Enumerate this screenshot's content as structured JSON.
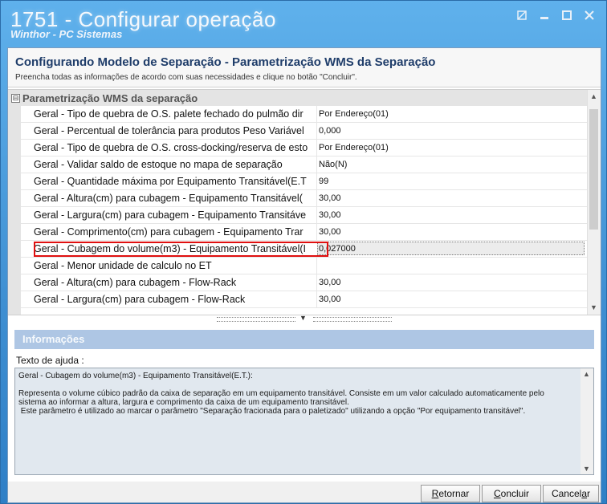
{
  "window": {
    "title": "1751 - Configurar operação",
    "subtitle": "Winthor - PC Sistemas"
  },
  "header": {
    "title": "Configurando Modelo de Separação - Parametrização WMS da Separação",
    "subtitle": "Preencha todas as informações de acordo com suas necessidades e clique no botão \"Concluir\"."
  },
  "grid": {
    "category": "Parametrização WMS da separação",
    "category_toggle": "⊟",
    "rows": [
      {
        "name": "Geral - Tipo de quebra de O.S. palete fechado do pulmão dir",
        "value": "Por Endereço(01)"
      },
      {
        "name": "Geral - Percentual de tolerância para produtos Peso Variável",
        "value": "0,000"
      },
      {
        "name": "Geral - Tipo de quebra de O.S. cross-docking/reserva de esto",
        "value": "Por Endereço(01)"
      },
      {
        "name": "Geral - Validar saldo de estoque no mapa de separação",
        "value": "Não(N)"
      },
      {
        "name": "Geral - Quantidade máxima por Equipamento Transitável(E.T",
        "value": "99"
      },
      {
        "name": "Geral - Altura(cm) para cubagem - Equipamento Transitável(",
        "value": "30,00"
      },
      {
        "name": "Geral - Largura(cm) para cubagem - Equipamento Transitáve",
        "value": "30,00"
      },
      {
        "name": "Geral - Comprimento(cm) para cubagem - Equipamento Trar",
        "value": "30,00"
      },
      {
        "name": "Geral - Cubagem do volume(m3) - Equipamento Transitável(I",
        "value": "0,027000"
      },
      {
        "name": "Geral - Menor unidade de calculo no ET",
        "value": ""
      },
      {
        "name": "Geral - Altura(cm) para cubagem - Flow-Rack",
        "value": "30,00"
      },
      {
        "name": "Geral - Largura(cm) para cubagem - Flow-Rack",
        "value": "30,00"
      }
    ]
  },
  "info": {
    "title": "Informações",
    "help_label": "Texto de ajuda :",
    "help_text": "Geral - Cubagem do volume(m3) - Equipamento Transitável(E.T.):\n\nRepresenta o volume cúbico padrão da caixa de separação em um equipamento transitável. Consiste em um valor calculado automaticamente pelo sistema ao informar a altura, largura e comprimento da caixa de um equipamento transitável.\n Este parâmetro é utilizado ao marcar o parâmetro \"Separação fracionada para o paletizado\" utilizando a opção \"Por equipamento transitável\"."
  },
  "buttons": {
    "back": {
      "first": "R",
      "rest": "etornar"
    },
    "finish": {
      "first": "C",
      "rest": "oncluir"
    },
    "cancel": {
      "first": "Cancel",
      "u": "a",
      "rest": "r"
    }
  },
  "colors": {
    "accent": "#1f3d6a",
    "highlight": "#e01010",
    "info_header": "#aec6e4"
  }
}
